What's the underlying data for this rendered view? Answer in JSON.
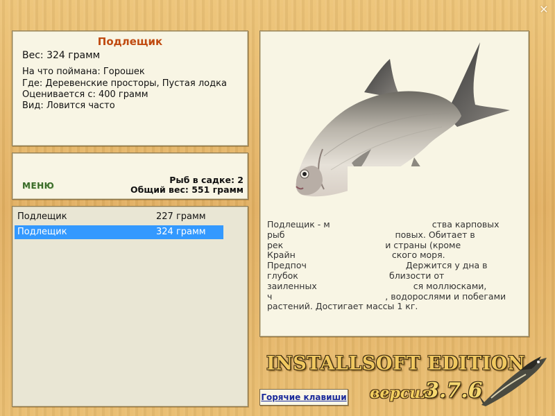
{
  "window": {
    "close_glyph": "✕"
  },
  "info": {
    "title": "Подлещик",
    "weight": "Вес: 324 грамм",
    "lines": [
      "На что поймана: Горошек",
      "Где: Деревенские просторы, Пустая лодка",
      "Оценивается с: 400 грамм",
      "Вид: Ловится часто"
    ]
  },
  "stats": {
    "menu_label": "МЕНЮ",
    "fish_count": "Рыб в садке: 2",
    "total_weight": "Общий вес: 551 грамм"
  },
  "catch_list": [
    {
      "name": "Подлещик",
      "weight": "227 грамм",
      "selected": false
    },
    {
      "name": "Подлещик",
      "weight": "324 грамм",
      "selected": true
    }
  ],
  "detail": {
    "image_icon": "bream-fish-image",
    "description": "Подлещик - м                                     ства карповых рыб                                        повых. Обитает в рек                                     и страны (кроме Крайн                                   ского моря. Предпоч                                    Держится у дна в глубок                                 близости от заиленных                                   ся моллюсками, ч                                         , водорослями и побегами растений. Достигает массы 1 кг."
  },
  "footer": {
    "hotkeys_label": "Горячие клавиши",
    "edition_text": "INSTALLSOFT EDITION",
    "version_label": "версия",
    "version_number": "3.7.6"
  },
  "colors": {
    "title": "#c04a10",
    "selection": "#3399ff",
    "menu": "#3a6a28",
    "link": "#1a2a9a"
  }
}
